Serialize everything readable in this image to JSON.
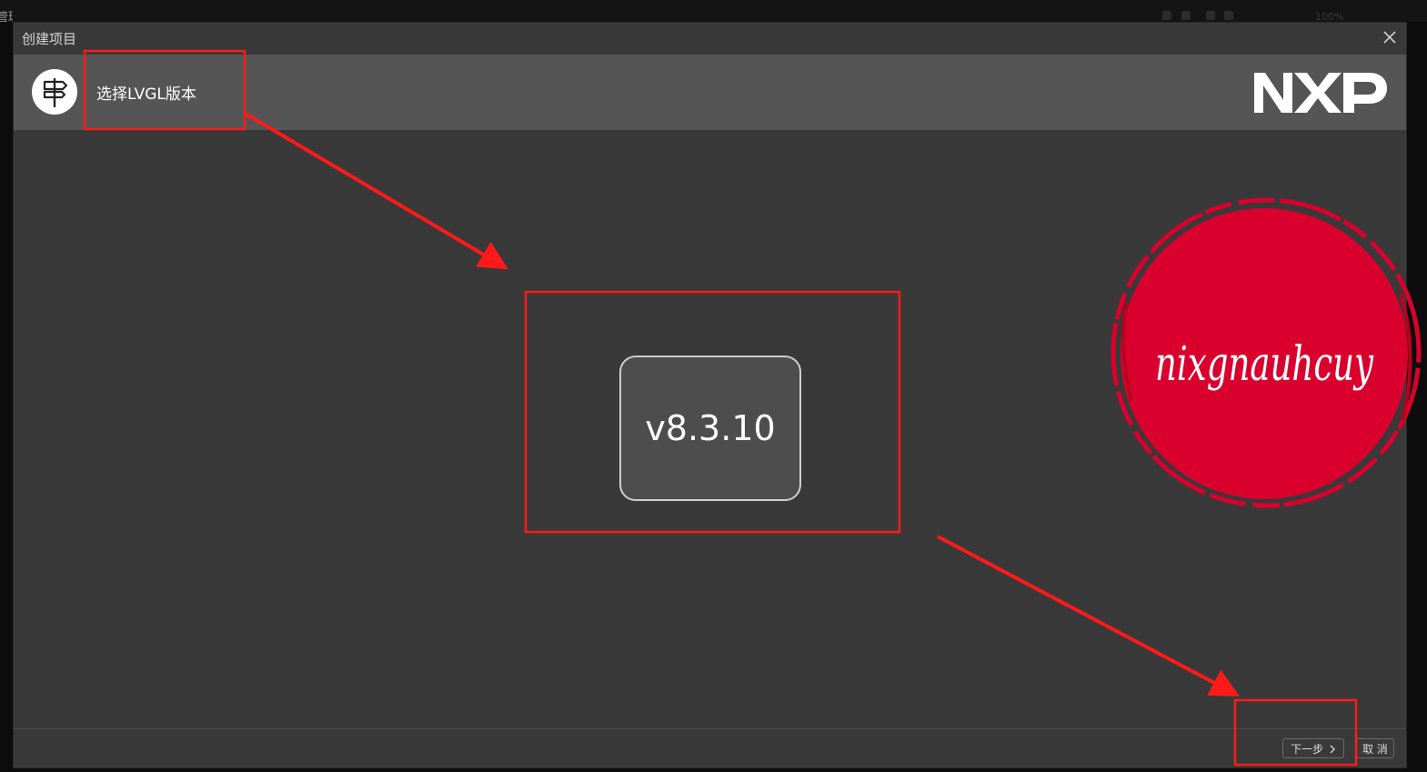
{
  "background": {
    "left_text": "管理",
    "zoom_text": "100%"
  },
  "dialog": {
    "title": "创建项目",
    "step_title": "选择LVGL版本",
    "logo_text": "NXP",
    "version_label": "v8.3.10",
    "seal_text": "nixgnauhcuy",
    "buttons": {
      "next": "下一步",
      "next_icon": "chevron-right-icon",
      "cancel": "取 消"
    }
  },
  "colors": {
    "dialog_bg": "#393939",
    "header_bg": "#555555",
    "annotation_red": "#ff1a1a",
    "seal_red": "#d9002e"
  }
}
